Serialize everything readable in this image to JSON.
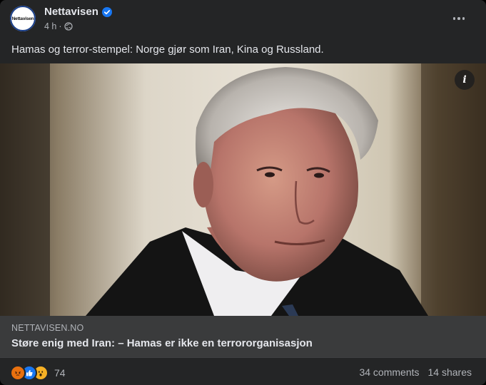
{
  "post": {
    "page_name": "Nettavisen",
    "avatar_text": "Nettavisen",
    "time": "4 h",
    "separator": "·",
    "caption": "Hamas og terror-stempel: Norge gjør som Iran, Kina og Russland.",
    "icons": {
      "verified": "verified-badge-icon",
      "audience": "globe-icon",
      "more": "more-options-icon",
      "info": "info-icon"
    }
  },
  "link": {
    "domain": "NETTAVISEN.NO",
    "title": "Støre enig med Iran: – Hamas er ikke en terrororganisasjon"
  },
  "engagement": {
    "reactions": [
      "angry",
      "like",
      "wow"
    ],
    "reaction_count": "74",
    "comments": "34 comments",
    "shares": "14 shares"
  },
  "colors": {
    "card_bg": "#242526",
    "link_bg": "#3a3b3c",
    "text_primary": "#e4e6eb",
    "text_secondary": "#b0b3b8",
    "verified_blue": "#1877f2"
  }
}
